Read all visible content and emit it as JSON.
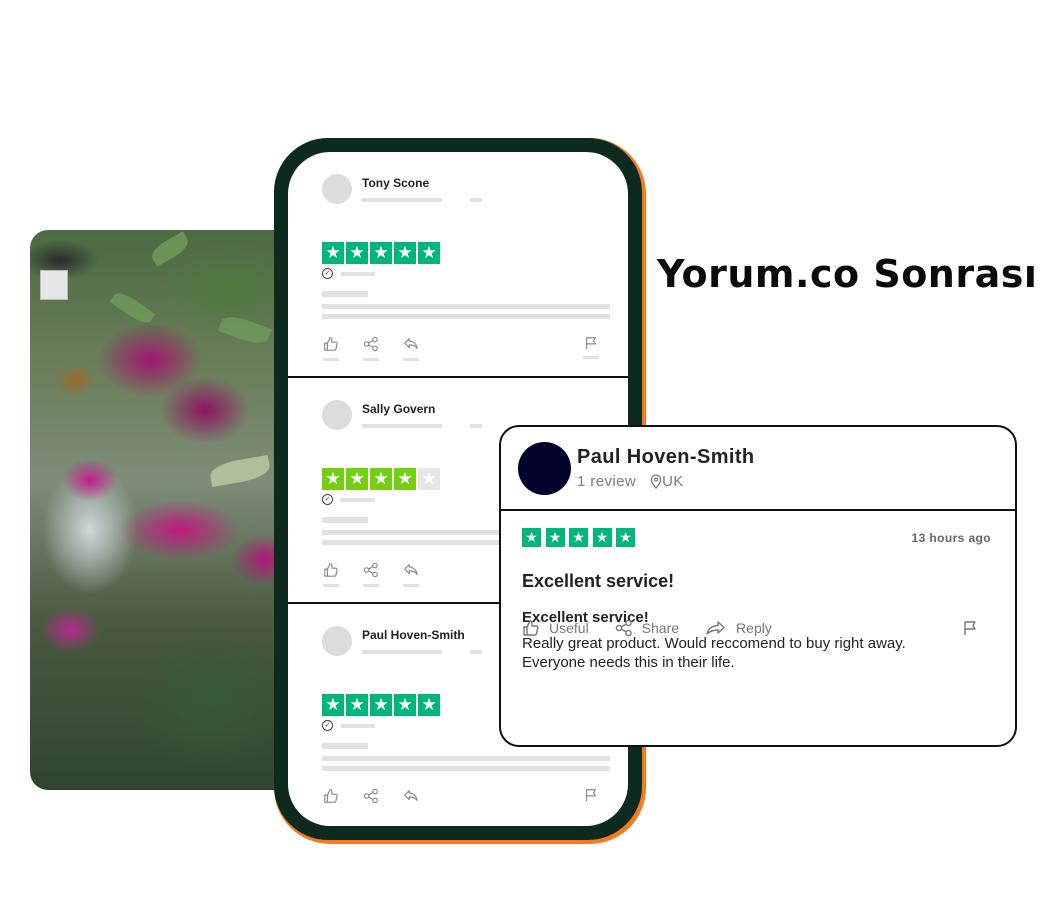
{
  "headline": "Yorum.co Sonrası",
  "colors": {
    "phone_frame": "#0c2a1d",
    "phone_accent": "#f47b20",
    "star_green": "#00b67a",
    "star_lime": "#73cf11",
    "star_empty": "#e6e6e6",
    "avatar_dark": "#02022c"
  },
  "photo": {
    "description": "orchid garden photo",
    "icon": "photo-image"
  },
  "phone_reviews": [
    {
      "name": "Tony Scone",
      "rating": 5,
      "star_color": "green"
    },
    {
      "name": "Sally Govern",
      "rating": 4,
      "star_color": "lime"
    },
    {
      "name": "Paul Hoven-Smith",
      "rating": 5,
      "star_color": "green"
    }
  ],
  "review_card": {
    "name": "Paul Hoven-Smith",
    "reviews_count": "1 review",
    "location": "UK",
    "rating": 5,
    "time": "13 hours ago",
    "title": "Excellent service!",
    "subtitle": "Excellent service!",
    "text_line1": "Really great product. Would reccomend to buy right away.",
    "text_line2": "Everyone needs this in their life.",
    "actions": {
      "useful": "Useful",
      "share": "Share",
      "reply": "Reply"
    }
  }
}
